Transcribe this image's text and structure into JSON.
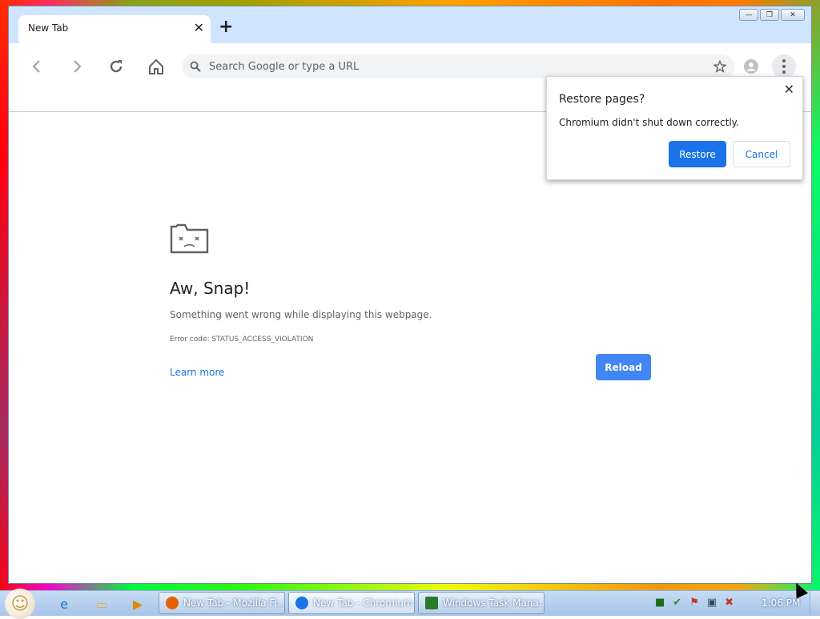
{
  "window": {
    "title": "New Tab"
  },
  "tabs": [
    {
      "title": "New Tab",
      "close": "✕"
    }
  ],
  "new_tab": "+",
  "window_controls": {
    "minimize": "—",
    "maximize": "❐",
    "close": "✕"
  },
  "omnibox": {
    "placeholder": "Search Google or type a URL",
    "value": ""
  },
  "error": {
    "title": "Aw, Snap!",
    "message": "Something went wrong while displaying this webpage.",
    "code": "Error code: STATUS_ACCESS_VIOLATION",
    "learn_more": "Learn more",
    "reload": "Reload"
  },
  "restore_bubble": {
    "title": "Restore pages?",
    "message": "Chromium didn't shut down correctly.",
    "restore": "Restore",
    "cancel": "Cancel",
    "close": "✕"
  },
  "taskbar": {
    "items": [
      {
        "label": "New Tab - Mozilla Fi...",
        "icon": "firefox-icon",
        "color": "#e66000"
      },
      {
        "label": "New Tab - Chromium",
        "icon": "chromium-icon",
        "color": "#1a73e8"
      },
      {
        "label": "Windows Task Mana...",
        "icon": "task-manager-icon",
        "color": "#2a7a2a"
      }
    ],
    "clock": "1:06 PM"
  },
  "colors": {
    "accent": "#1a73e8",
    "reload": "#4285f4",
    "tabstrip": "#cfe5ff"
  }
}
